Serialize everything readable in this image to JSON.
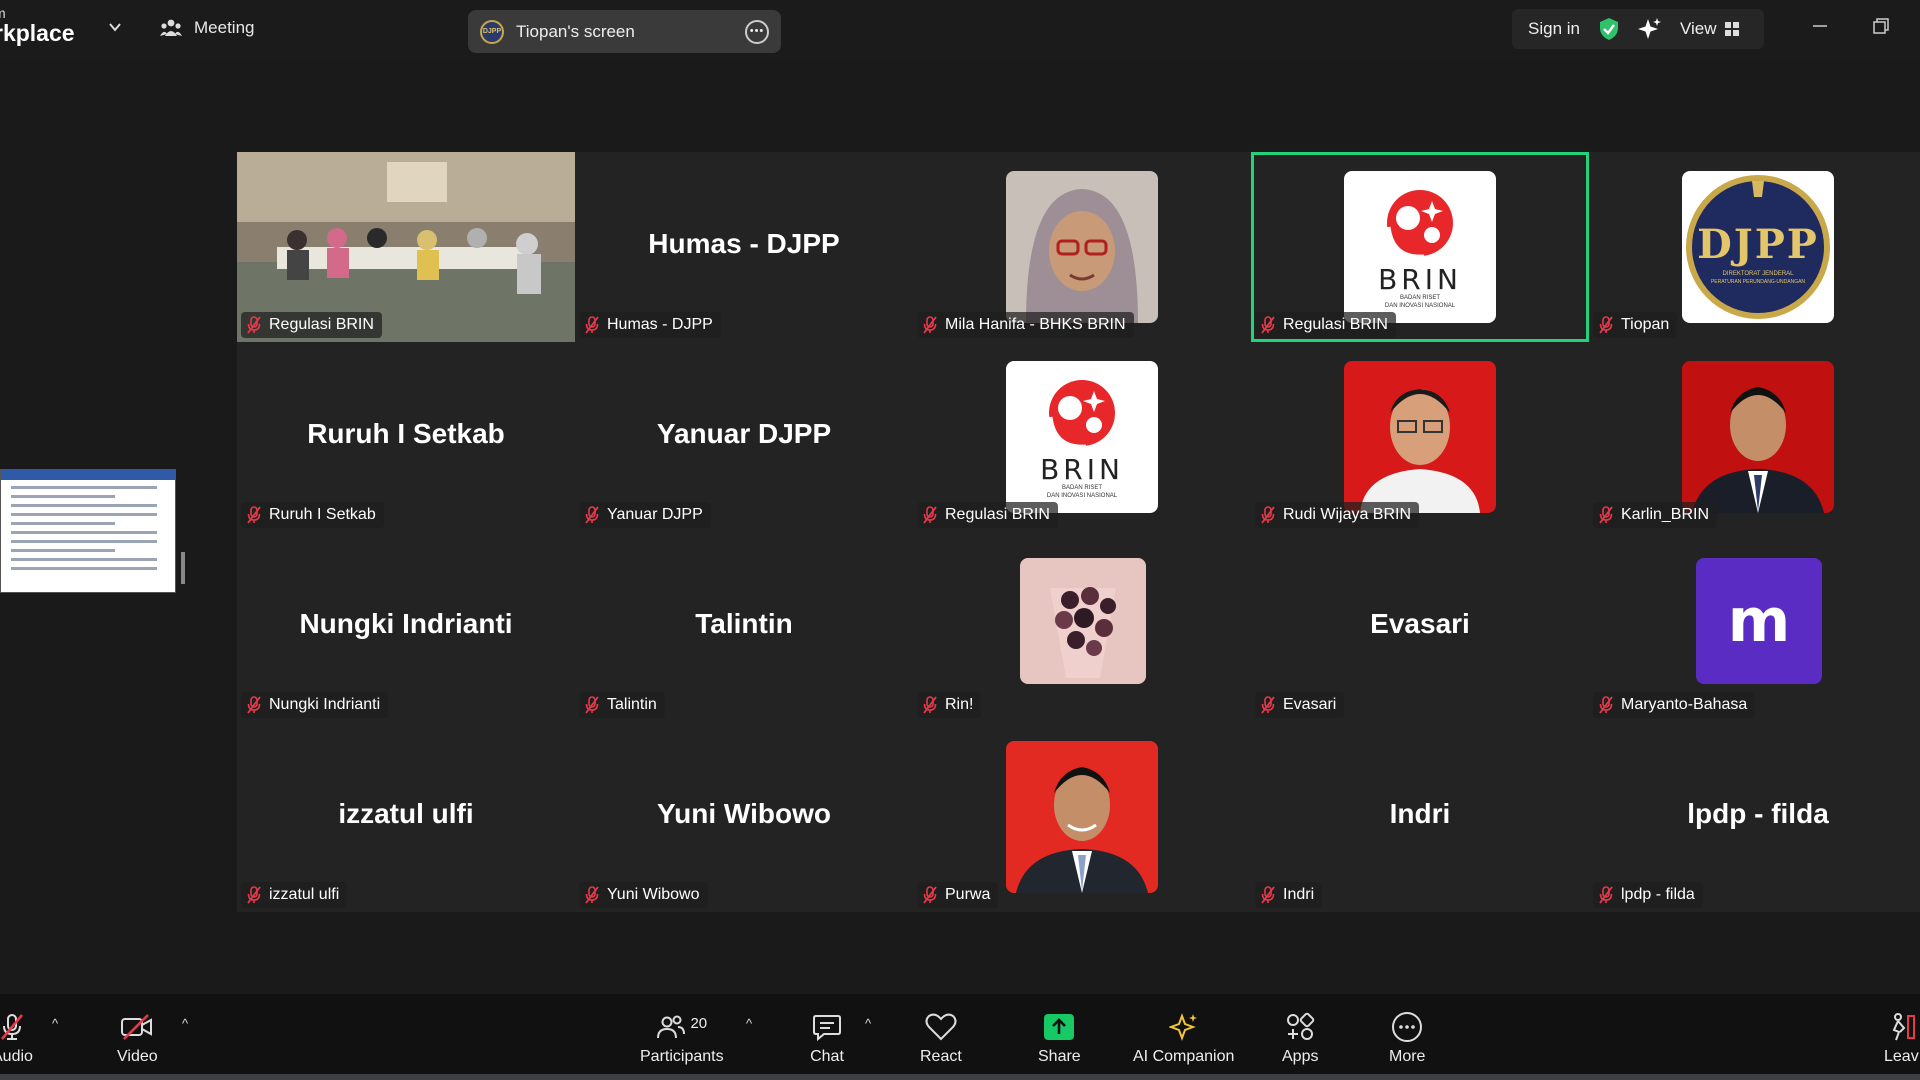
{
  "window": {
    "brand_small": "m",
    "brand_big": "rkplace",
    "meeting_label": "Meeting",
    "screen_share_label": "Tiopan's screen",
    "screen_share_badge": "DJPP",
    "sign_in": "Sign in",
    "view_label": "View"
  },
  "colors": {
    "active_speaker": "#22d37a",
    "mic_off": "#e8394a",
    "share_green": "#17c964",
    "ai_gold": "#f3c63a"
  },
  "tiles": [
    {
      "label": "Regulasi BRIN",
      "big": "",
      "kind": "room-photo"
    },
    {
      "label": "Humas - DJPP",
      "big": "Humas - DJPP",
      "kind": "name"
    },
    {
      "label": "Mila Hanifa - BHKS BRIN",
      "big": "",
      "kind": "portrait-hijab"
    },
    {
      "label": "Regulasi BRIN",
      "big": "",
      "kind": "brin-logo",
      "active": true
    },
    {
      "label": "Tiopan",
      "big": "",
      "kind": "djpp-logo"
    },
    {
      "label": "Ruruh I Setkab",
      "big": "Ruruh I Setkab",
      "kind": "name"
    },
    {
      "label": "Yanuar DJPP",
      "big": "Yanuar DJPP",
      "kind": "name"
    },
    {
      "label": "Regulasi BRIN",
      "big": "",
      "kind": "brin-logo"
    },
    {
      "label": "Rudi Wijaya BRIN",
      "big": "",
      "kind": "portrait-red"
    },
    {
      "label": "Karlin_BRIN",
      "big": "",
      "kind": "portrait-suit"
    },
    {
      "label": "Nungki Indrianti",
      "big": "Nungki Indrianti",
      "kind": "name"
    },
    {
      "label": "Talintin",
      "big": "Talintin",
      "kind": "name"
    },
    {
      "label": "Rin!",
      "big": "",
      "kind": "flowers"
    },
    {
      "label": "Evasari",
      "big": "Evasari",
      "kind": "name"
    },
    {
      "label": "Maryanto-Bahasa",
      "big": "",
      "kind": "letter-m",
      "letter": "m"
    },
    {
      "label": "izzatul ulfi",
      "big": "izzatul ulfi",
      "kind": "name"
    },
    {
      "label": "Yuni Wibowo",
      "big": "Yuni Wibowo",
      "kind": "name"
    },
    {
      "label": "Purwa",
      "big": "",
      "kind": "portrait-red-suit"
    },
    {
      "label": "Indri",
      "big": "Indri",
      "kind": "name"
    },
    {
      "label": "lpdp - filda",
      "big": "lpdp - filda",
      "kind": "name"
    }
  ],
  "brin_logo": {
    "text": "BRIN",
    "sub1": "BADAN RISET",
    "sub2": "DAN INOVASI NASIONAL"
  },
  "djpp_logo": {
    "text": "DJPP",
    "sub1": "DIREKTORAT JENDERAL",
    "sub2": "PERATURAN PERUNDANG-UNDANGAN"
  },
  "toolbar": {
    "audio": "Audio",
    "video": "Video",
    "participants": "Participants",
    "participants_count": "20",
    "chat": "Chat",
    "react": "React",
    "share": "Share",
    "ai_companion": "AI Companion",
    "apps": "Apps",
    "more": "More",
    "leave": "Leav"
  }
}
